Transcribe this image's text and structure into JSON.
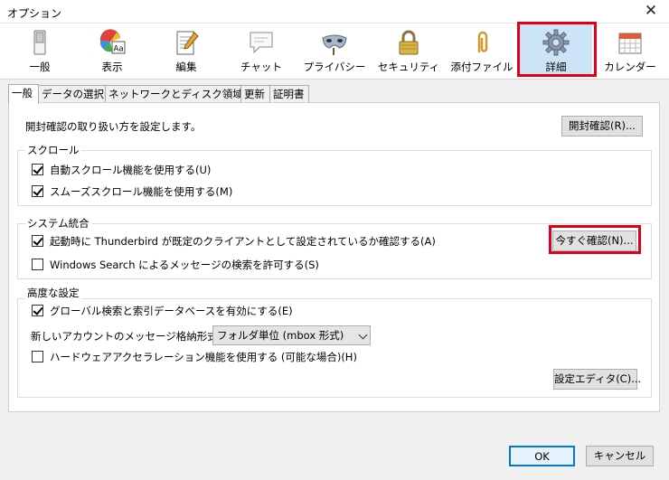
{
  "window": {
    "title": "オプション",
    "close_glyph": "✕"
  },
  "toolbar": {
    "items": [
      {
        "label": "一般",
        "icon": "general-switch-icon"
      },
      {
        "label": "表示",
        "icon": "display-palette-icon"
      },
      {
        "label": "編集",
        "icon": "compose-notepad-icon"
      },
      {
        "label": "チャット",
        "icon": "chat-bubble-icon"
      },
      {
        "label": "プライバシー",
        "icon": "privacy-mask-icon"
      },
      {
        "label": "セキュリティ",
        "icon": "security-lock-icon"
      },
      {
        "label": "添付ファイル",
        "icon": "attachment-clip-icon"
      },
      {
        "label": "詳細",
        "icon": "advanced-gear-icon"
      },
      {
        "label": "カレンダー",
        "icon": "calendar-icon"
      }
    ],
    "active_index": 7,
    "active_bg": "#cce4f7"
  },
  "subtabs": [
    "一般",
    "データの選択",
    "ネットワークとディスク領域",
    "更新",
    "証明書"
  ],
  "general": {
    "receipt_text": "開封確認の取り扱い方を設定します。",
    "receipt_button": "開封確認(R)...",
    "scroll": {
      "title": "スクロール",
      "autoscroll": "自動スクロール機能を使用する(U)",
      "smoothscroll": "スムーズスクロール機能を使用する(M)"
    },
    "system": {
      "title": "システム統合",
      "default_check": "起動時に Thunderbird が既定のクライアントとして設定されているか確認する(A)",
      "check_now": "今すぐ確認(N)...",
      "windows_search": "Windows Search によるメッセージの検索を許可する(S)"
    },
    "advanced": {
      "title": "高度な設定",
      "global_search": "グローバル検索と索引データベースを有効にする(E)",
      "storage_label": "新しいアカウントのメッセージ格納形式(T):",
      "storage_value": "フォルダ単位 (mbox 形式)",
      "hw_accel": "ハードウェアアクセラレーション機能を使用する (可能な場合)(H)",
      "config_editor": "設定エディタ(C)..."
    }
  },
  "footer": {
    "ok": "OK",
    "cancel": "キャンセル"
  },
  "colors": {
    "highlight": "#e0001b",
    "ok_border": "#0078d7"
  }
}
